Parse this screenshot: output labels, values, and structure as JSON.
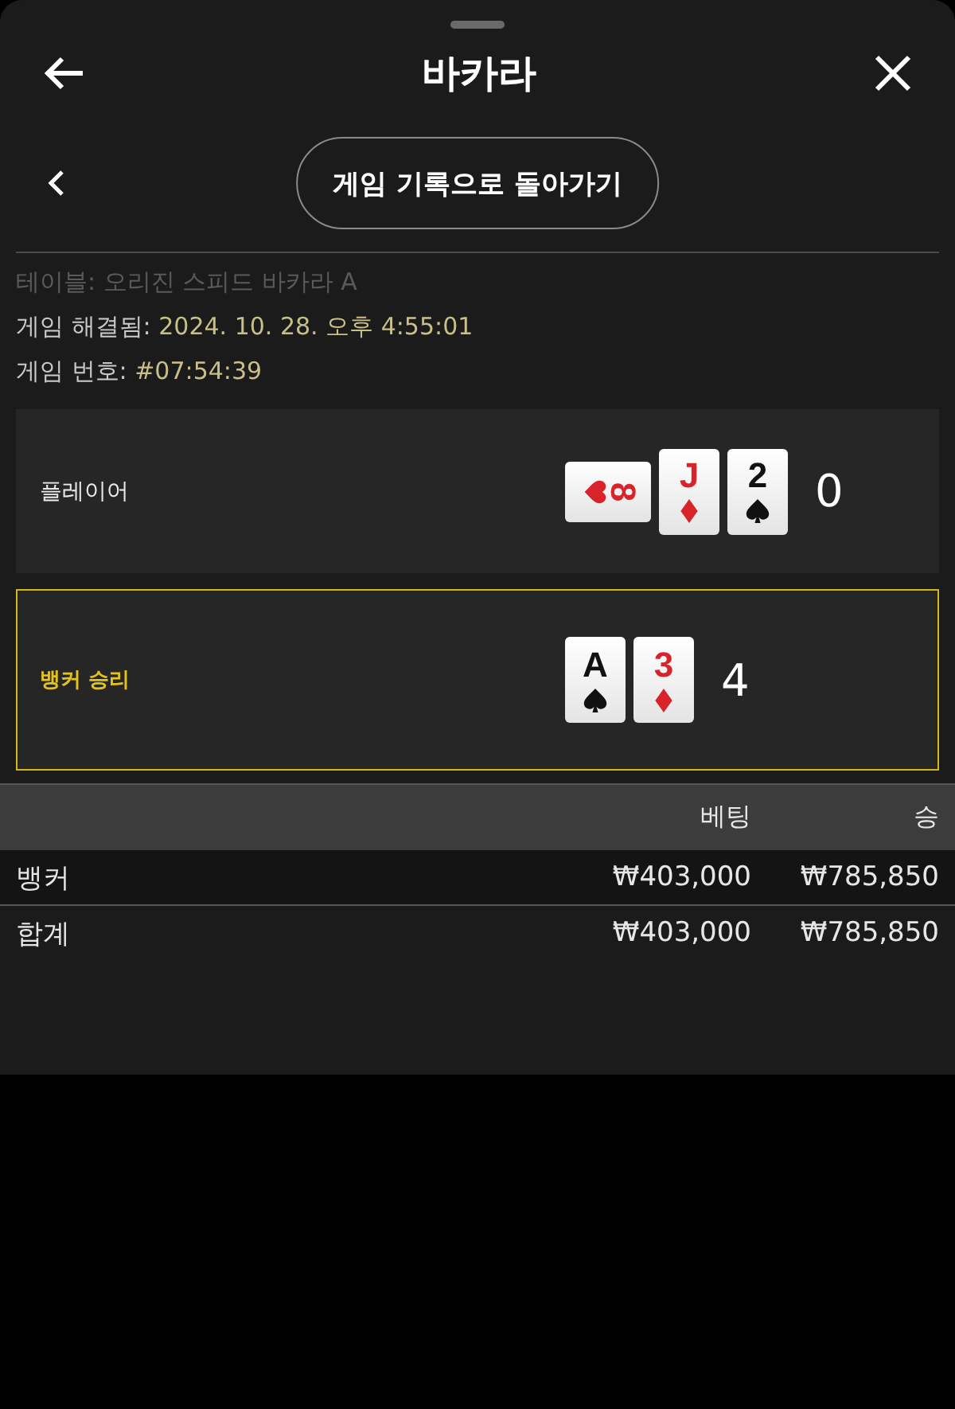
{
  "header": {
    "title": "바카라"
  },
  "back_link": {
    "label": "게임 기록으로 돌아가기"
  },
  "info": [
    {
      "label": "테이블:",
      "value": "오리진 스피드 바카라 A",
      "faded": true
    },
    {
      "label": "게임 해결됨:",
      "value": "2024. 10. 28. 오후 4:55:01",
      "faded": false
    },
    {
      "label": "게임 번호:",
      "value": "#07:54:39",
      "faded": false
    }
  ],
  "hands": [
    {
      "label": "플레이어",
      "winner": false,
      "score": "0",
      "cards": [
        {
          "rank": "8",
          "kind": "hearts",
          "sideways": true
        },
        {
          "rank": "J",
          "kind": "diamonds",
          "sideways": false
        },
        {
          "rank": "2",
          "kind": "spades",
          "sideways": false
        }
      ]
    },
    {
      "label": "뱅커 승리",
      "winner": true,
      "score": "4",
      "cards": [
        {
          "rank": "A",
          "kind": "spades",
          "sideways": false
        },
        {
          "rank": "3",
          "kind": "diamonds",
          "sideways": false
        }
      ]
    }
  ],
  "table": {
    "columns": [
      "베팅",
      "승"
    ],
    "rows": [
      {
        "name": "뱅커",
        "bet": "₩403,000",
        "win": "₩785,850"
      },
      {
        "name": "합계",
        "bet": "₩403,000",
        "win": "₩785,850"
      }
    ]
  }
}
